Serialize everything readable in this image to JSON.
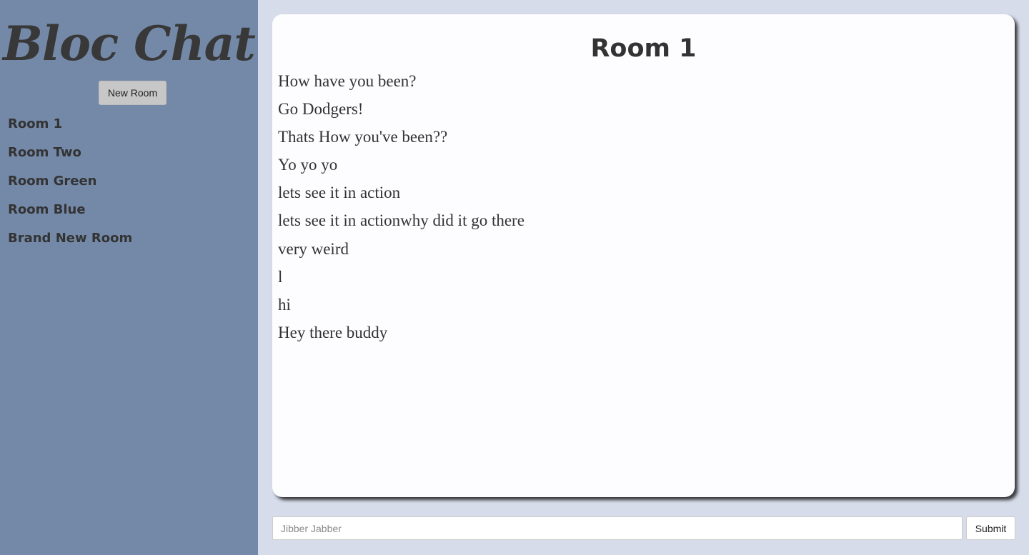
{
  "sidebar": {
    "app_title": "Bloc Chat",
    "new_room_label": "New Room",
    "rooms": [
      {
        "label": "Room 1"
      },
      {
        "label": "Room Two"
      },
      {
        "label": "Room Green"
      },
      {
        "label": "Room Blue"
      },
      {
        "label": "Brand New Room"
      }
    ]
  },
  "chat": {
    "room_title": "Room 1",
    "messages": [
      {
        "text": "How have you been?"
      },
      {
        "text": "Go Dodgers!"
      },
      {
        "text": "Thats How you've been??"
      },
      {
        "text": "Yo yo yo"
      },
      {
        "text": "lets see it in action"
      },
      {
        "text": "lets see it in actionwhy did it go there"
      },
      {
        "text": "very weird"
      },
      {
        "text": "l"
      },
      {
        "text": "hi"
      },
      {
        "text": "Hey there buddy"
      }
    ]
  },
  "composer": {
    "input_value": "",
    "input_placeholder": "Jibber Jabber",
    "submit_label": "Submit"
  },
  "colors": {
    "sidebar_bg": "#7489a8",
    "page_bg": "#d6dcea",
    "card_bg": "#fdfdff",
    "text": "#333333"
  }
}
